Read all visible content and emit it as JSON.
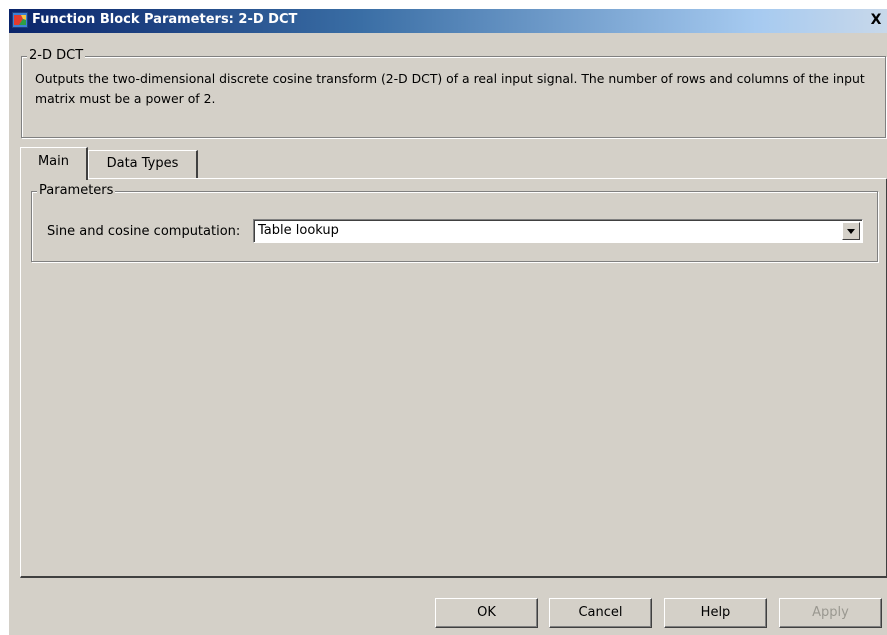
{
  "window": {
    "title": "Function Block Parameters: 2-D DCT",
    "close_glyph": "X",
    "icon": "simulink-block-icon"
  },
  "block_group": {
    "legend": "2-D DCT",
    "description": "Outputs the two-dimensional discrete cosine transform (2-D DCT) of a real input signal. The number of rows and columns of the input matrix must be a power of 2."
  },
  "tabs": [
    {
      "label": "Main",
      "selected": true
    },
    {
      "label": "Data Types",
      "selected": false
    }
  ],
  "parameters": {
    "legend": "Parameters",
    "sine_cosine_label": "Sine and cosine computation:",
    "sine_cosine_value": "Table lookup"
  },
  "buttons": {
    "ok": "OK",
    "cancel": "Cancel",
    "help": "Help",
    "apply": "Apply",
    "apply_enabled": false
  },
  "colors": {
    "dialog_face": "#d4d0c8",
    "titlebar_start": "#0a246a",
    "titlebar_end": "#a6caf0",
    "disabled_text": "#9a9890"
  }
}
